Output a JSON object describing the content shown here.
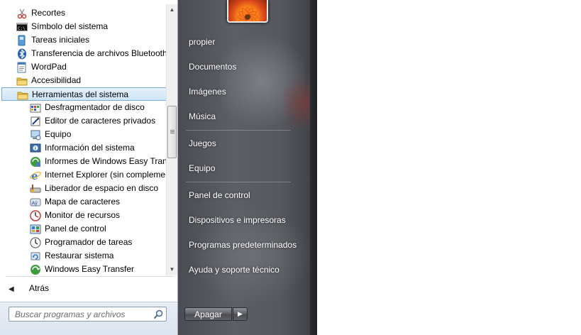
{
  "programs": {
    "items": [
      {
        "label": "Recortes",
        "icon": "scissors-icon",
        "indent": 0
      },
      {
        "label": "Símbolo del sistema",
        "icon": "command-prompt-icon",
        "indent": 0
      },
      {
        "label": "Tareas iniciales",
        "icon": "getting-started-icon",
        "indent": 0
      },
      {
        "label": "Transferencia de archivos Bluetooth",
        "icon": "bluetooth-icon",
        "indent": 0
      },
      {
        "label": "WordPad",
        "icon": "wordpad-icon",
        "indent": 0
      },
      {
        "label": "Accesibilidad",
        "icon": "folder-icon",
        "indent": 0
      },
      {
        "label": "Herramientas del sistema",
        "icon": "folder-icon",
        "indent": 0,
        "selected": true
      },
      {
        "label": "Desfragmentador de disco",
        "icon": "defrag-icon",
        "indent": 1
      },
      {
        "label": "Editor de caracteres privados",
        "icon": "char-editor-icon",
        "indent": 1
      },
      {
        "label": "Equipo",
        "icon": "computer-icon",
        "indent": 1
      },
      {
        "label": "Información del sistema",
        "icon": "system-info-icon",
        "indent": 1
      },
      {
        "label": "Informes de Windows Easy Transfer",
        "icon": "easy-transfer-reports-icon",
        "indent": 1
      },
      {
        "label": "Internet Explorer (sin complementos)",
        "icon": "internet-explorer-icon",
        "indent": 1
      },
      {
        "label": "Liberador de espacio en disco",
        "icon": "disk-cleanup-icon",
        "indent": 1
      },
      {
        "label": "Mapa de caracteres",
        "icon": "character-map-icon",
        "indent": 1
      },
      {
        "label": "Monitor de recursos",
        "icon": "resource-monitor-icon",
        "indent": 1
      },
      {
        "label": "Panel de control",
        "icon": "control-panel-icon",
        "indent": 1
      },
      {
        "label": "Programador de tareas",
        "icon": "task-scheduler-icon",
        "indent": 1
      },
      {
        "label": "Restaurar sistema",
        "icon": "system-restore-icon",
        "indent": 1
      },
      {
        "label": "Windows Easy Transfer",
        "icon": "easy-transfer-icon",
        "indent": 1
      }
    ],
    "back_label": "Atrás"
  },
  "search": {
    "placeholder": "Buscar programas y archivos"
  },
  "right_panel": {
    "items": [
      "propier",
      "Documentos",
      "Imágenes",
      "Música",
      "Juegos",
      "Equipo",
      "Panel de control",
      "Dispositivos e impresoras",
      "Programas predeterminados",
      "Ayuda y soporte técnico"
    ],
    "shutdown_label": "Apagar"
  },
  "colors": {
    "selected_fill": "#cfe5f7",
    "selected_border": "#7aaad6",
    "right_pane": "#5d5f66"
  }
}
